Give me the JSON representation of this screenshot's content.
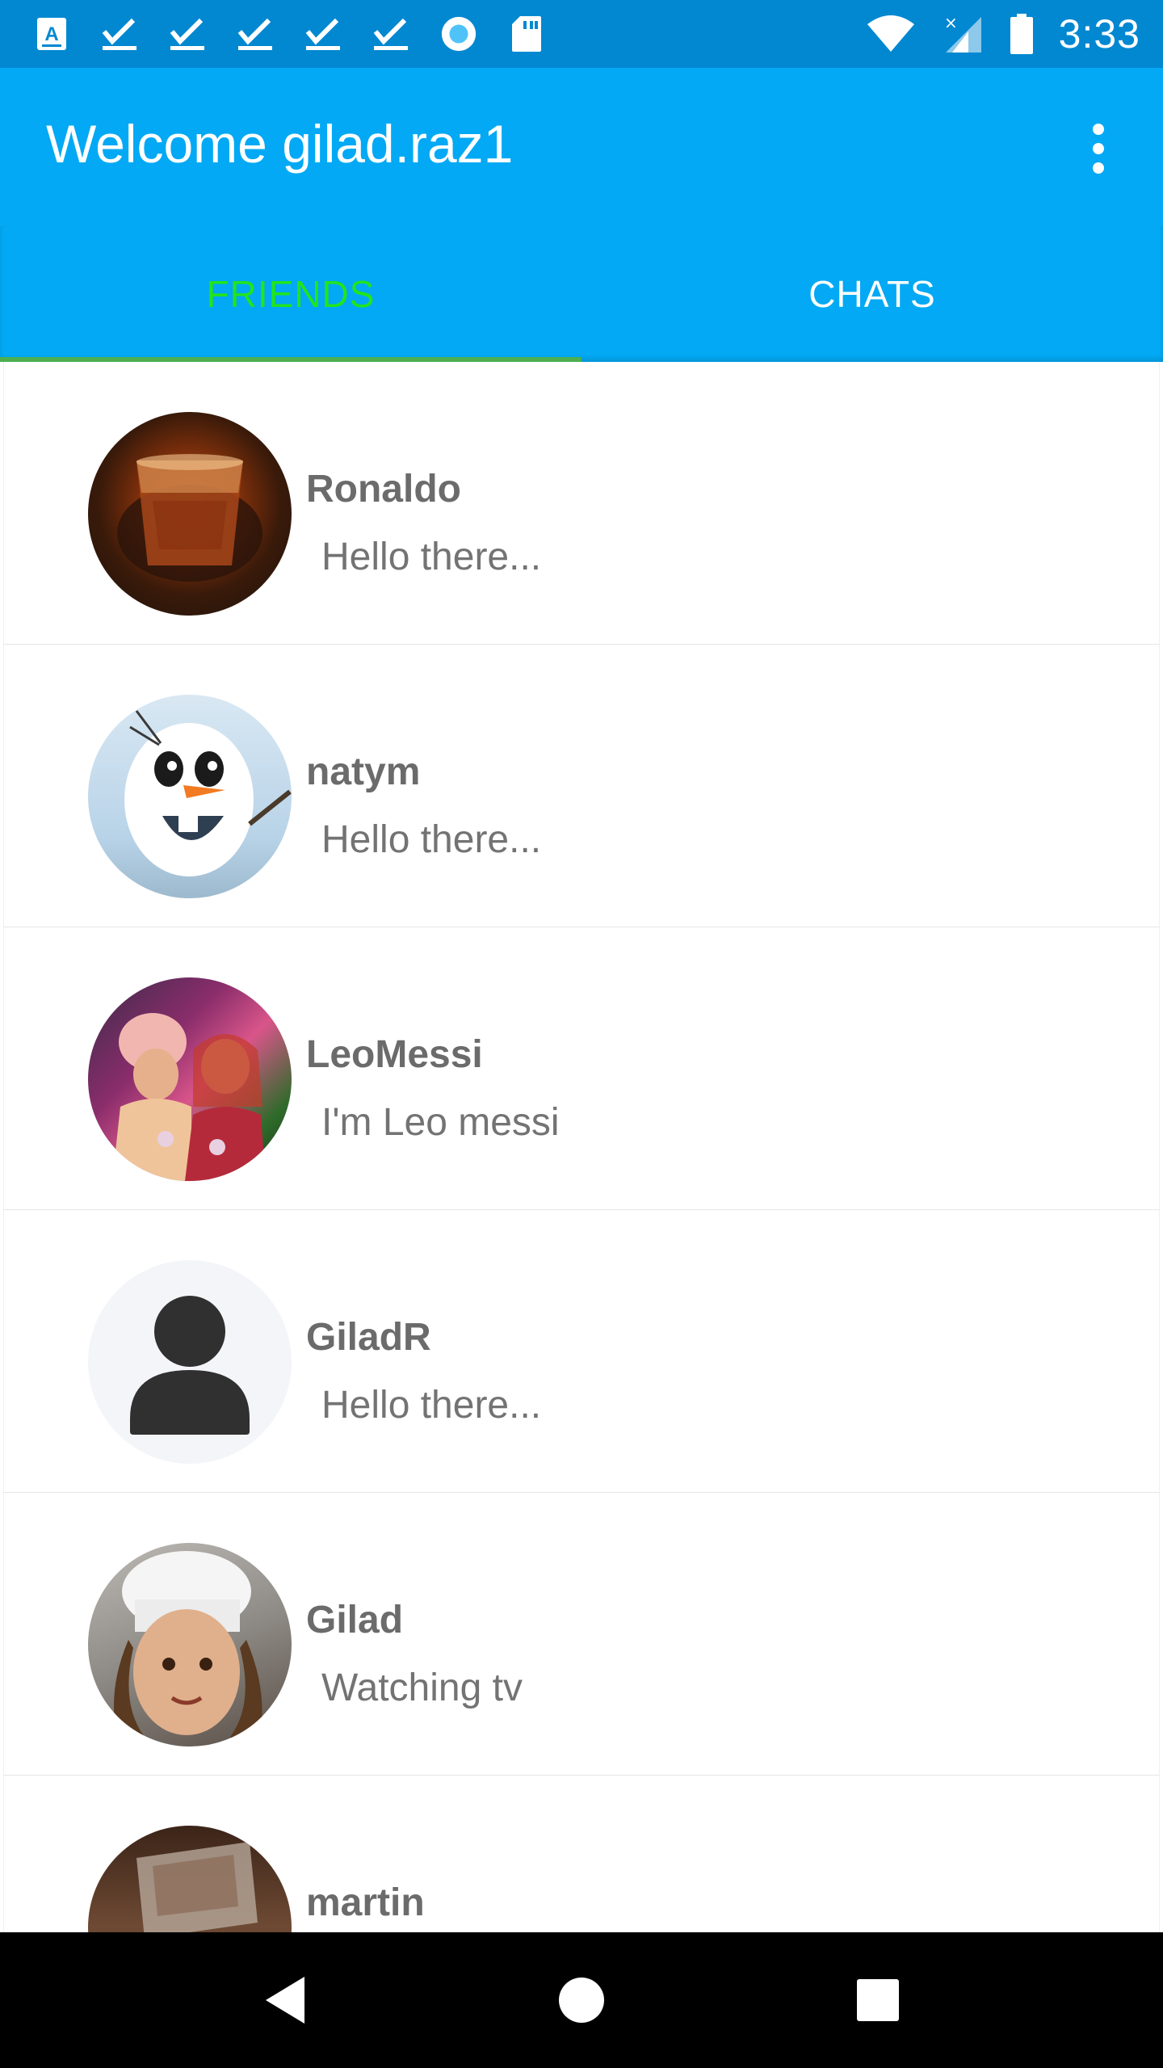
{
  "status_bar": {
    "time": "3:33",
    "left_icons": [
      "font-notification-icon",
      "check-icon",
      "check-icon",
      "check-icon",
      "check-icon",
      "check-icon",
      "circle-notification-icon",
      "sd-card-icon"
    ],
    "right_icons": [
      "wifi-icon",
      "cell-signal-icon",
      "battery-icon"
    ]
  },
  "app_bar": {
    "title": "Welcome gilad.raz1",
    "menu_icon": "more-vert-icon"
  },
  "tabs": [
    {
      "label": "FRIENDS",
      "active": true
    },
    {
      "label": "CHATS",
      "active": false
    }
  ],
  "friends": [
    {
      "name": "Ronaldo",
      "status": "Hello there..."
    },
    {
      "name": "natym",
      "status": "Hello there..."
    },
    {
      "name": "LeoMessi",
      "status": "I'm Leo messi"
    },
    {
      "name": "GiladR",
      "status": "Hello there..."
    },
    {
      "name": "Gilad",
      "status": "Watching tv"
    },
    {
      "name": "martin",
      "status": ""
    }
  ],
  "nav_bar": {
    "buttons": [
      "back-icon",
      "home-icon",
      "recents-icon"
    ]
  },
  "colors": {
    "status_bar": "#0288d1",
    "app_bar": "#03a9f4",
    "active_tab_text": "#22e51b",
    "tab_indicator": "#4caf50"
  }
}
